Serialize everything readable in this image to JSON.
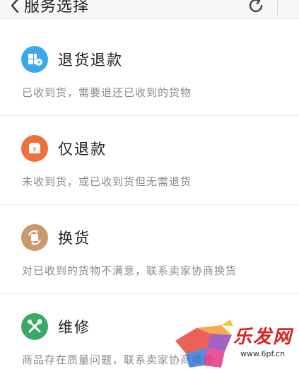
{
  "header": {
    "title": "服务选择"
  },
  "options": [
    {
      "title": "退货退款",
      "desc": "已收到货，需要退还已收到的货物",
      "color": "#3aa8ea",
      "icon": "return-refund-icon"
    },
    {
      "title": "仅退款",
      "desc": "未收到货，或已收到货但无需退货",
      "color": "#f0703a",
      "icon": "refund-only-icon"
    },
    {
      "title": "换货",
      "desc": "对已收到的货物不满意，联系卖家协商换货",
      "color": "#c89a6e",
      "icon": "exchange-icon"
    },
    {
      "title": "维修",
      "desc": "商品存在质量问题，联系卖家协商维修",
      "color": "#3aa866",
      "icon": "repair-tools-icon"
    }
  ],
  "watermark": {
    "text": "乐发网",
    "url": "www.6pf.cn"
  }
}
